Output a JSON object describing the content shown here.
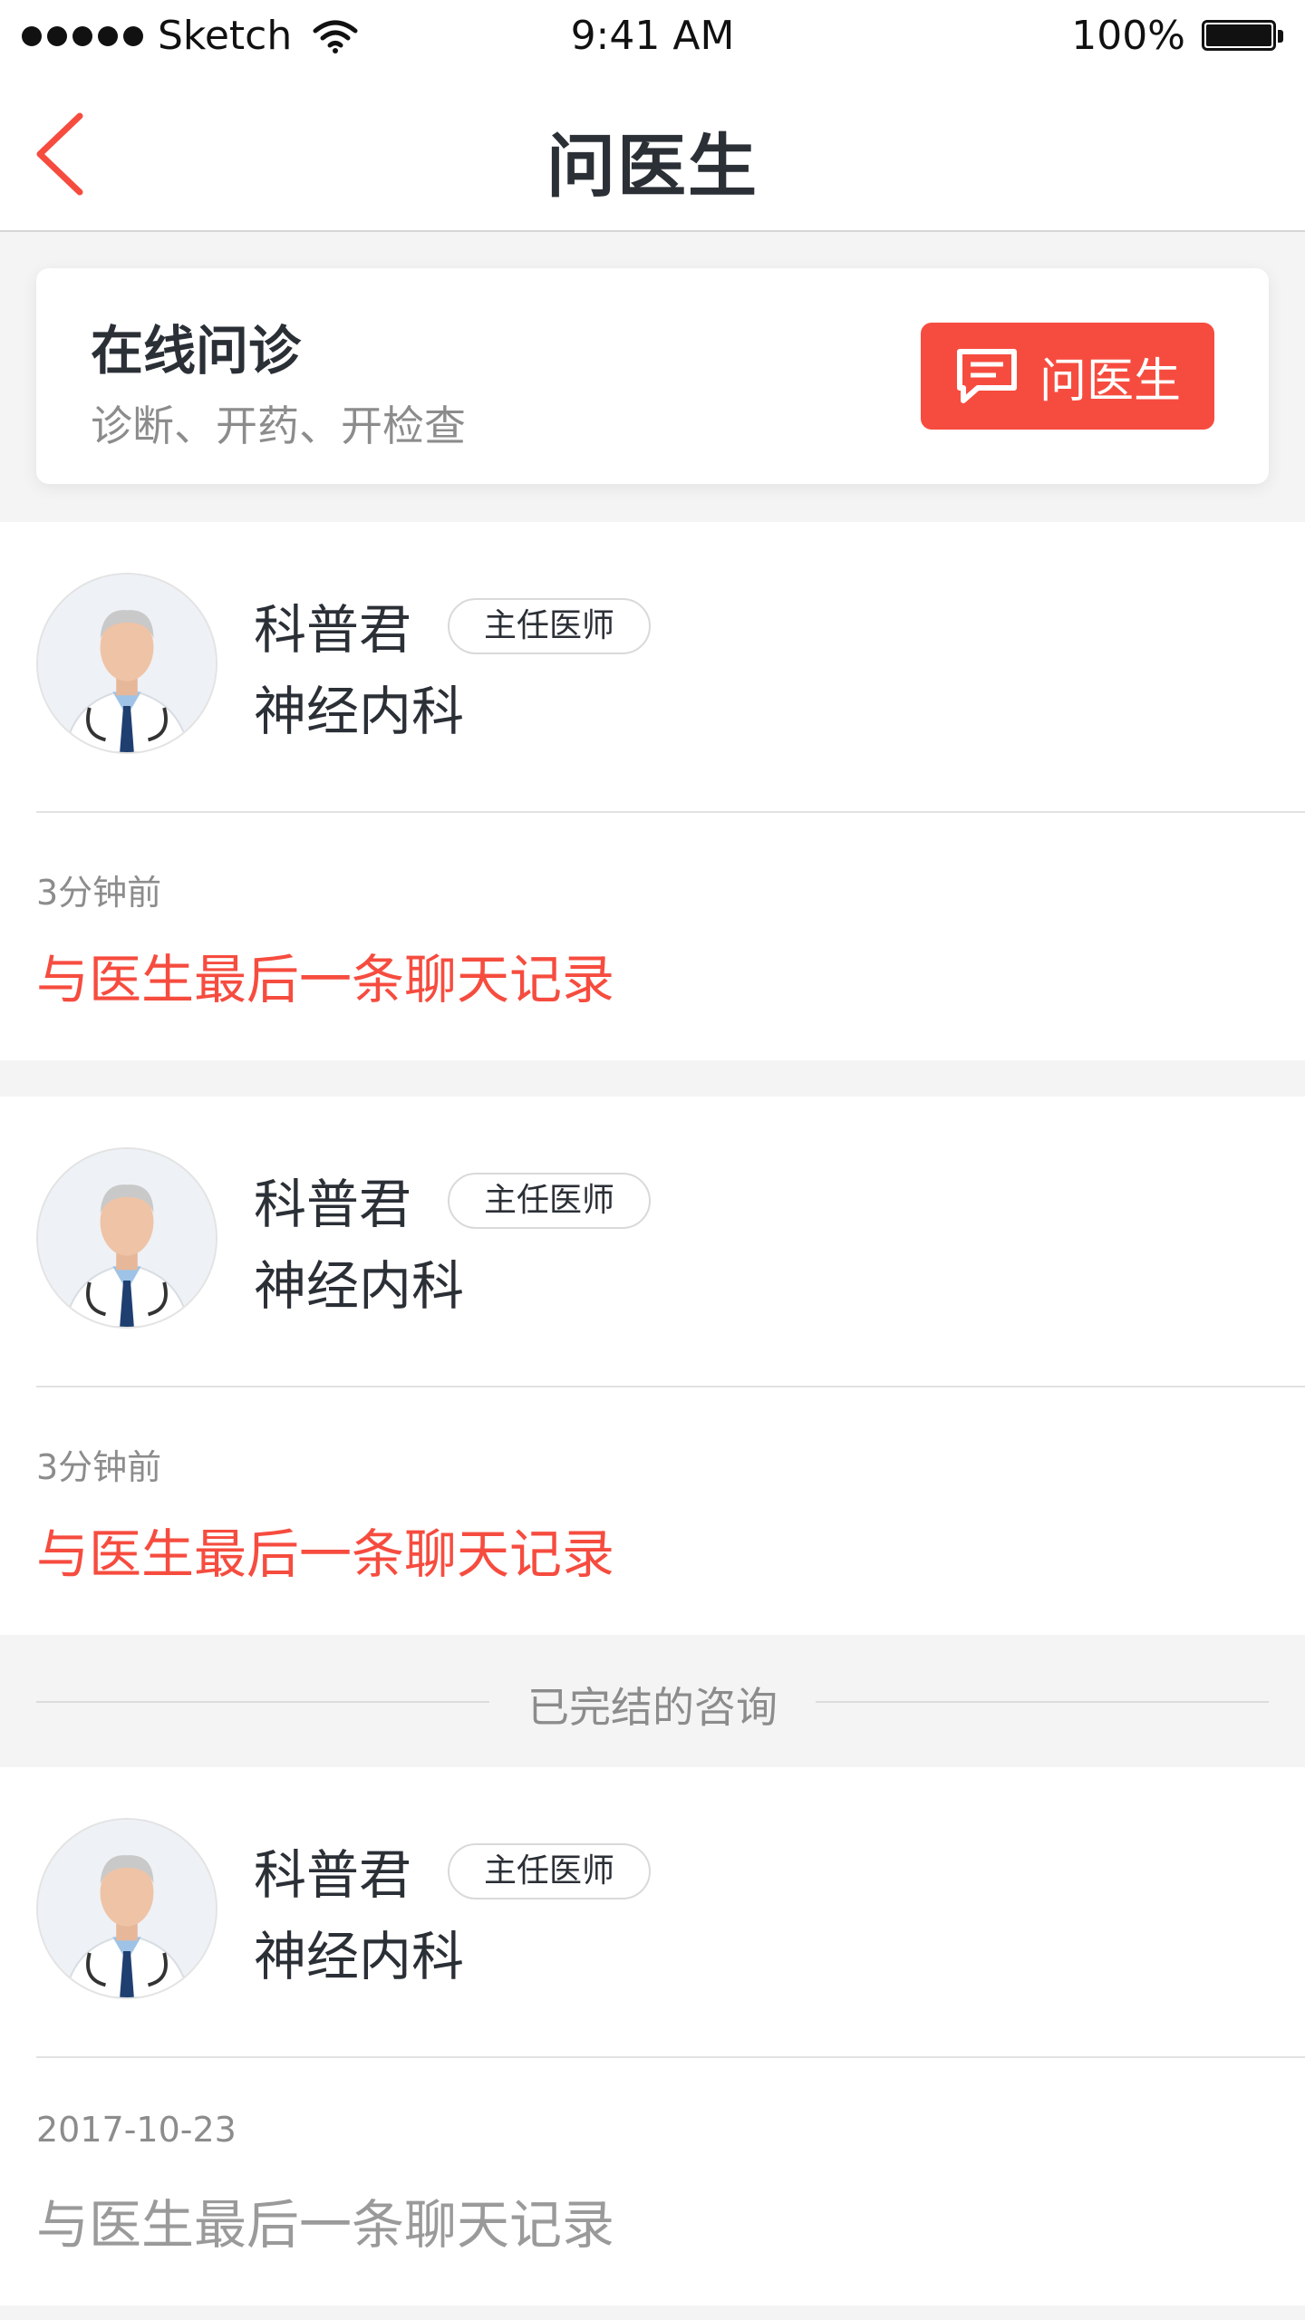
{
  "status_bar": {
    "carrier": "Sketch",
    "time": "9:41 AM",
    "battery": "100%"
  },
  "nav": {
    "title": "问医生",
    "back_icon": "chevron-left-icon"
  },
  "consult_card": {
    "title": "在线问诊",
    "subtitle": "诊断、开药、开检查",
    "button_label": "问医生",
    "button_icon": "chat-bubble-icon"
  },
  "consultations": [
    {
      "doctor_name": "科普君",
      "doctor_title": "主任医师",
      "department": "神经内科",
      "time": "3分钟前",
      "last_message": "与医生最后一条聊天记录"
    },
    {
      "doctor_name": "科普君",
      "doctor_title": "主任医师",
      "department": "神经内科",
      "time": "3分钟前",
      "last_message": "与医生最后一条聊天记录"
    }
  ],
  "closed_section": {
    "label": "已完结的咨询",
    "items": [
      {
        "doctor_name": "科普君",
        "doctor_title": "主任医师",
        "department": "神经内科",
        "time": "2017-10-23",
        "last_message": "与医生最后一条聊天记录"
      }
    ]
  },
  "colors": {
    "accent": "#f64c3f",
    "text_primary": "#2b2f36",
    "text_secondary": "#8c8c8c",
    "background": "#f4f4f4"
  }
}
